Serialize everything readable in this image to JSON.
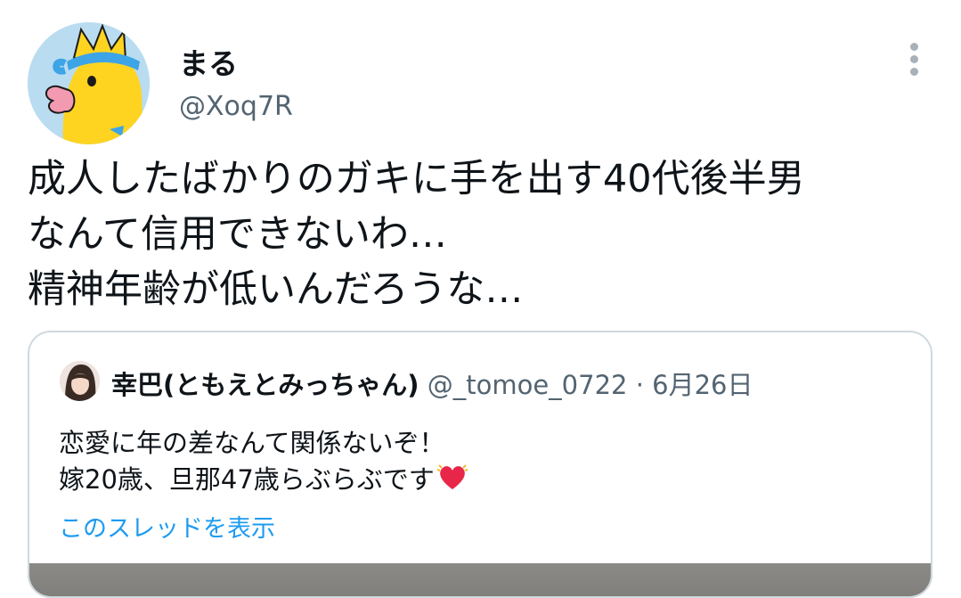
{
  "author": {
    "name": "まる",
    "handle": "@Xoq7R",
    "avatar_icon": "cartoon-chick-avatar"
  },
  "tweet": {
    "lines": [
      "成人したばかりのガキに手を出す40代後半男",
      "なんて信用できないわ…",
      "精神年齢が低いんだろうな…"
    ]
  },
  "quoted": {
    "name": "幸巴(ともえとみっちゃん)",
    "handle": "@_tomoe_0722",
    "separator": "·",
    "date": "6月26日",
    "lines": [
      "恋愛に年の差なんて関係ないぞ！",
      "嫁20歳、旦那47歳らぶらぶです"
    ],
    "thread_link": "このスレッドを表示"
  },
  "colors": {
    "link": "#1d9bf0",
    "secondary": "#536471",
    "heart": "#e8264a"
  }
}
